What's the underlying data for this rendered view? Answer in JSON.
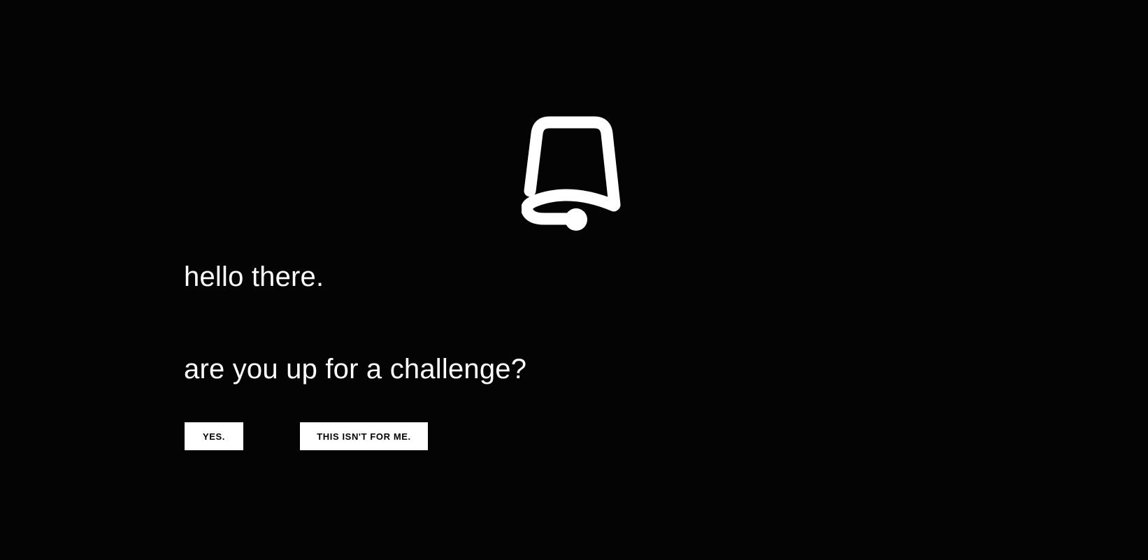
{
  "logo": {
    "icon": "bell-icon",
    "color": "#ffffff"
  },
  "greeting": "hello there.",
  "question": "are you up for a challenge?",
  "buttons": {
    "yes_label": "YES.",
    "no_label": "THIS ISN'T FOR ME."
  },
  "colors": {
    "background": "#040404",
    "text": "#ffffff",
    "button_background": "#ffffff",
    "button_text": "#000000"
  }
}
